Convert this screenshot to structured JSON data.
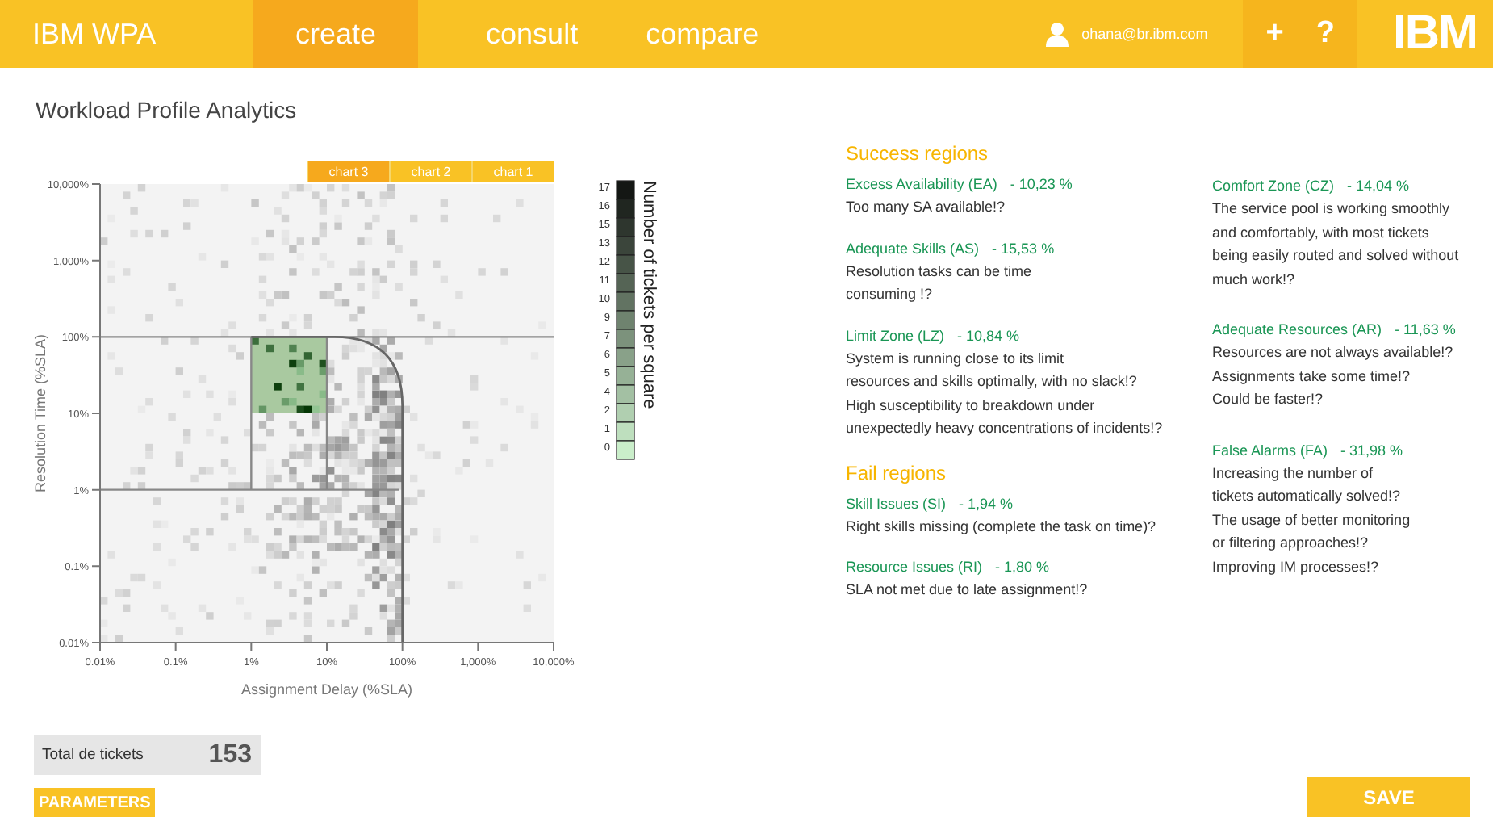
{
  "header": {
    "brand": "IBM WPA",
    "tabs": [
      {
        "label": "create",
        "selected": true
      },
      {
        "label": "consult",
        "selected": false
      },
      {
        "label": "compare",
        "selected": false
      }
    ],
    "user_email": "ohana@br.ibm.com",
    "actions": [
      "+",
      "?"
    ],
    "logo": "IBM"
  },
  "page_title": "Workload Profile Analytics",
  "chart": {
    "tabs": [
      {
        "label": "chart 3",
        "selected": true
      },
      {
        "label": "chart 2",
        "selected": false
      },
      {
        "label": "chart 1",
        "selected": false
      }
    ],
    "xticks": [
      "0.01%",
      "0.1%",
      "1%",
      "10%",
      "100%",
      "1,000%",
      "10,000%"
    ],
    "yticks": [
      "10,000%",
      "1,000%",
      "100%",
      "10%",
      "1%",
      "0.1%",
      "0.01%"
    ],
    "xlabel": "Assignment Delay (%SLA)",
    "ylabel": "Resolution Time (%SLA)",
    "legend": {
      "title": "Number of tickets per square",
      "labels": [
        "17",
        "16",
        "15",
        "13",
        "12",
        "11",
        "10",
        "9",
        "7",
        "6",
        "5",
        "4",
        "2",
        "1",
        "0"
      ]
    }
  },
  "regions": {
    "columns": [
      [
        {
          "kind": "heading",
          "text": "Success regions"
        },
        {
          "kind": "entry",
          "name": "Excess Availability (EA)",
          "value": "- 10,23 %",
          "lines": [
            "Too many SA available!?"
          ]
        },
        {
          "kind": "entry",
          "name": "Adequate Skills (AS)",
          "value": "- 15,53 %",
          "lines": [
            "Resolution tasks can be time",
            "consuming !?"
          ]
        },
        {
          "kind": "entry",
          "name": "Limit Zone (LZ)",
          "value": "- 10,84 %",
          "lines": [
            "System is running close to its limit",
            "resources and skills optimally, with no slack!?",
            "High susceptibility to breakdown under",
            "unexpectedly heavy concentrations of incidents!?"
          ]
        },
        {
          "kind": "heading",
          "text": "Fail regions"
        },
        {
          "kind": "entry",
          "name": "Skill Issues (SI)",
          "value": "- 1,94 %",
          "lines": [
            "Right skills missing (complete the task on time)?"
          ]
        },
        {
          "kind": "entry",
          "name": "Resource Issues (RI)",
          "value": "- 1,80 %",
          "lines": [
            "SLA not met due to late assignment!?"
          ]
        }
      ],
      [
        {
          "kind": "entry",
          "name": "Comfort Zone (CZ)",
          "value": "- 14,04 %",
          "lines": [
            "The service pool is working smoothly",
            "and comfortably, with most tickets",
            "being easily routed and solved without",
            "much work!?"
          ]
        },
        {
          "kind": "entry",
          "name": "Adequate Resources (AR)",
          "value": "- 11,63 %",
          "lines": [
            "Resources are not always available!?",
            "Assignments take some time!?",
            "Could be faster!?"
          ]
        },
        {
          "kind": "entry",
          "name": "False Alarms (FA)",
          "value": "- 31,98 %",
          "lines": [
            "Increasing the number of",
            "tickets automatically solved!?",
            "The usage of better monitoring",
            "or filtering approaches!?",
            "Improving IM processes!?"
          ]
        }
      ]
    ]
  },
  "total": {
    "label": "Total de tickets",
    "value": "153"
  },
  "parameters_button": "PARAMETERS",
  "save_button": "SAVE"
}
